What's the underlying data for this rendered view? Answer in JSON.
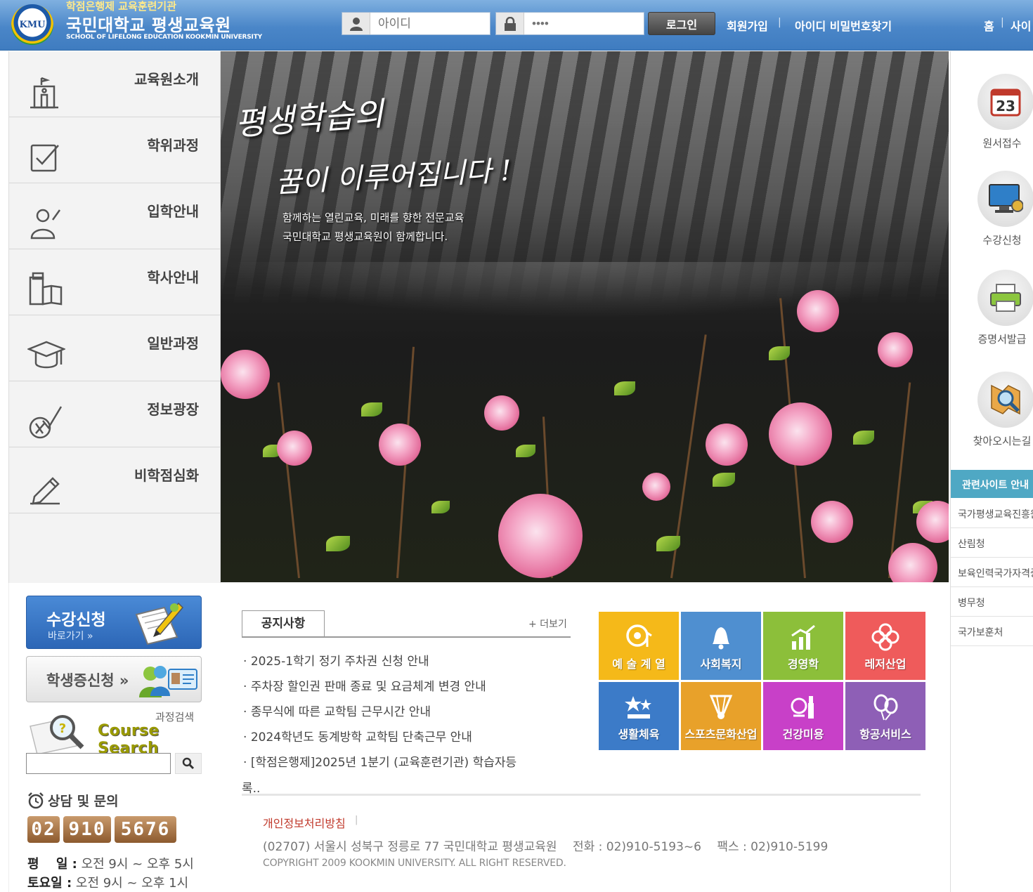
{
  "header": {
    "logo_badge": "KMU",
    "sub_title": "학점은행제 교육훈련기관",
    "title": "국민대학교 평생교육원",
    "eng_title": "SCHOOL OF LIFELONG EDUCATION KOOKMIN UNIVERSITY",
    "id_placeholder": "아이디",
    "pw_placeholder": "••••",
    "login_label": "로그인",
    "join_label": "회원가입",
    "find_label": "아이디 비밀번호찾기",
    "home_label": "홈",
    "sitemap_label": "사이"
  },
  "nav": {
    "items": [
      {
        "label": "교육원소개",
        "icon": "building-icon"
      },
      {
        "label": "학위과정",
        "icon": "checkbox-icon"
      },
      {
        "label": "입학안내",
        "icon": "person-icon"
      },
      {
        "label": "학사안내",
        "icon": "book-icon"
      },
      {
        "label": "일반과정",
        "icon": "graduation-cap-icon"
      },
      {
        "label": "정보광장",
        "icon": "info-check-icon"
      },
      {
        "label": "비학점심화",
        "icon": "pencil-icon"
      }
    ]
  },
  "hero": {
    "title1": "평생학습의",
    "title2": "꿈이 이루어집니다 !",
    "sub1": "함께하는 열린교육, 미래를 향한 전문교육",
    "sub2": "국민대학교 평생교육원이 함께합니다."
  },
  "quick": {
    "items": [
      {
        "label": "원서접수",
        "icon": "calendar-icon",
        "badge": "23"
      },
      {
        "label": "수강신청",
        "icon": "monitor-icon"
      },
      {
        "label": "증명서발급",
        "icon": "printer-icon"
      },
      {
        "label": "찾아오시는길",
        "icon": "map-search-icon"
      }
    ],
    "related_title": "관련사이트 안내",
    "related": [
      "국가평생교육진흥원",
      "산림청",
      "보육인력국가자격증",
      "병무청",
      "국가보훈처"
    ]
  },
  "left_panel": {
    "enroll_title": "수강신청",
    "enroll_sub": "바로가기 »",
    "idcard_title": "학생증신청 »",
    "search_kr": "과정검색",
    "search_en": "Course Search",
    "consult_title": "상담 및 문의",
    "phone": [
      "02",
      "910",
      "5676"
    ],
    "weekday_label": "평　 일 :",
    "weekday_hours": "오전 9시 ~ 오후 5시",
    "saturday_label": "토요일 :",
    "saturday_hours": "오전 9시 ~ 오후 1시"
  },
  "notices": {
    "tab": "공지사항",
    "more": "+ 더보기",
    "items": [
      "2025-1학기 정기 주차권 신청 안내",
      "주차장 할인권 판매 종료 및 요금체계 변경 안내",
      "종무식에 따른 교학팀 근무시간 안내",
      "2024학년도 동계방학 교학팀 단축근무 안내",
      "[학점은행제]2025년 1분기 (교육훈련기관) 학습자등"
    ],
    "wrap": "록.."
  },
  "tiles": [
    {
      "label": "예 술 계 열",
      "color": "#f5b919",
      "icon": "music-icon"
    },
    {
      "label": "사회복지",
      "color": "#4f8fd0",
      "icon": "bell-icon"
    },
    {
      "label": "경영학",
      "color": "#8cbf3a",
      "icon": "growth-chart-icon"
    },
    {
      "label": "레저산업",
      "color": "#ef5b5b",
      "icon": "clover-icon"
    },
    {
      "label": "생활체육",
      "color": "#3c7bc8",
      "icon": "trophy-icon"
    },
    {
      "label": "스포츠문화산업",
      "color": "#e8a12a",
      "icon": "shuttlecock-icon"
    },
    {
      "label": "건강미용",
      "color": "#c840c8",
      "icon": "cosmetic-icon"
    },
    {
      "label": "항공서비스",
      "color": "#8e5fb6",
      "icon": "balloon-icon"
    }
  ],
  "footer": {
    "privacy": "개인정보처리방침",
    "separator": "|",
    "address": "(02707) 서울시 성북구 정릉로 77 국민대학교 평생교육원　 전화 : 02)910-5193~6　 팩스 : 02)910-5199",
    "copyright": "COPYRIGHT 2009 KOOKMIN UNIVERSITY.  ALL RIGHT RESERVED."
  }
}
